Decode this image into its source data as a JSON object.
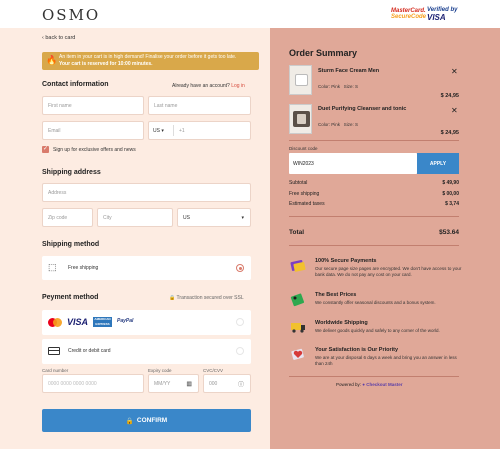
{
  "header": {
    "logo": "OSMO",
    "badge_mc_top": "MasterCard.",
    "badge_mc_bottom": "SecureCode",
    "badge_vbv_top": "Verified by",
    "badge_vbv_bottom": "VISA"
  },
  "checkout": {
    "back_label": "back to card",
    "banner_line1": "An item in your cart is in high demand! Finalise your order before it gets too late.",
    "banner_line2": "Your cart is reserved for 10:00 minutes.",
    "contact": {
      "title": "Contact information",
      "have_account": "Already have an account?",
      "login": "Log in",
      "first_name_placeholder": "First name",
      "last_name_placeholder": "Last name",
      "email_placeholder": "Email",
      "country_code": "US",
      "phone_placeholder": "+1",
      "signup_label": "Sign up for exclusive offers and news"
    },
    "shipping_address": {
      "title": "Shipping address",
      "address_placeholder": "Address",
      "zip_placeholder": "Zip code",
      "city_placeholder": "City",
      "country": "US"
    },
    "shipping_method": {
      "title": "Shipping method",
      "option_label": "Free shipping"
    },
    "payment": {
      "title": "Peyment method",
      "secure_note": "Transaction secured over SSL",
      "card_option_label": "Credit or debit card",
      "card_number_label": "Card number",
      "card_number_placeholder": "0000  0000  0000  0000",
      "expiry_label": "Expiry code",
      "expiry_placeholder": "MM/YY",
      "cvc_label": "CVC/CVV",
      "cvc_placeholder": "000",
      "amex_text": "AMERICAN EXPRESS",
      "paypal_text": "PayPal",
      "visa_text": "VISA"
    },
    "confirm_label": "CONFIRM"
  },
  "order_summary": {
    "title": "Order Summary",
    "items": [
      {
        "name": "Sturm Face Cream Men",
        "color": "Color: Pink",
        "size": "Size: S",
        "price": "$ 24,95"
      },
      {
        "name": "Duet Purifying Cleanser and tonic",
        "color": "Color: Pink",
        "size": "Size: S",
        "price": "$ 24,95"
      }
    ],
    "discount_label": "Discount code",
    "discount_value": "WIN2023",
    "apply_label": "APPLY",
    "subtotal_label": "Subtotal",
    "subtotal_value": "$ 49,90",
    "shipping_label": "Free shipping",
    "shipping_value": "$ 00,00",
    "taxes_label": "Estimated taxes",
    "taxes_value": "$ 3,74",
    "total_label": "Total",
    "total_value": "$53.64",
    "features": [
      {
        "title": "100% Secure Payments",
        "desc": "Our secure page size pages are encrypted. We don't have access to your bank data. We do not pay any cost on your card."
      },
      {
        "title": "The Best Prices",
        "desc": "We constantly offer seasonal discounts and a bonus system."
      },
      {
        "title": "Worldwide Shipping",
        "desc": "We deliver goods quickly and safely to any corner of the world."
      },
      {
        "title": "Your Satisfaction is Our Priority",
        "desc": "We are at your disposal 6 days a week and bring you an answer in less than 24h"
      }
    ],
    "powered_by": "Powered by:",
    "powered_company": "Checkout Master"
  },
  "colors": {
    "left_bg": "#fdece2",
    "right_bg": "#e0a898",
    "accent_blue": "#3a87c9",
    "accent_coral": "#d97b6c",
    "banner": "#d9a84a"
  }
}
